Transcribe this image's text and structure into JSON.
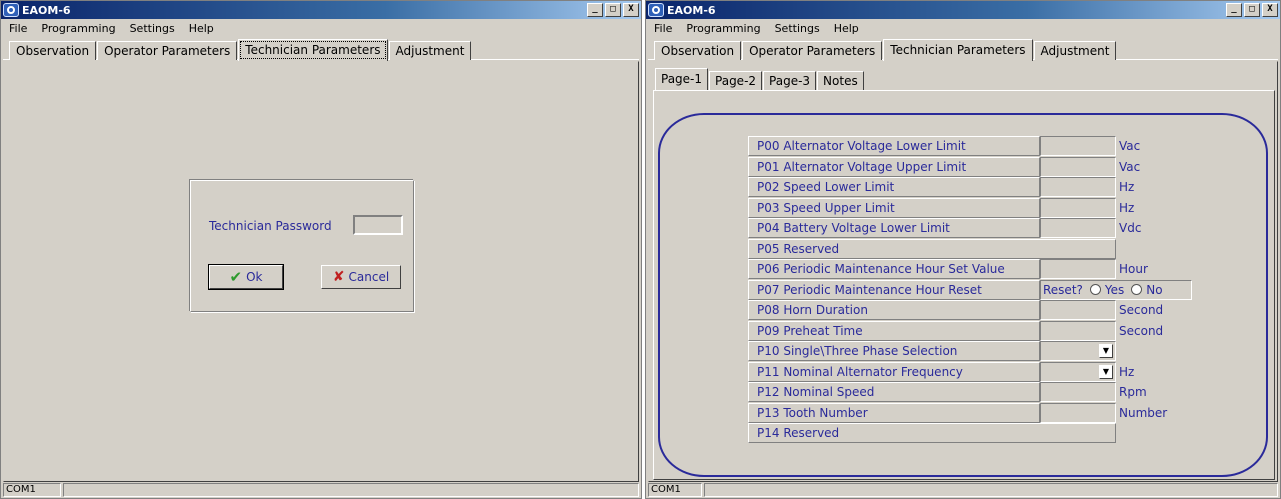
{
  "left_window": {
    "title": "EAOM-6",
    "buttons": {
      "minimize": "_",
      "maximize": "□",
      "close": "X"
    },
    "menu": [
      {
        "label": "File"
      },
      {
        "label": "Programming"
      },
      {
        "label": "Settings"
      },
      {
        "label": "Help"
      }
    ],
    "tabs": [
      "Observation",
      "Operator Parameters",
      "Technician Parameters",
      "Adjustment"
    ],
    "active_tab": "Technician Parameters",
    "dialog": {
      "password_label": "Technician Password",
      "password_value": "",
      "ok_label": "Ok",
      "cancel_label": "Cancel"
    },
    "status": {
      "port": "COM1",
      "message": ""
    }
  },
  "right_window": {
    "title": "EAOM-6",
    "buttons": {
      "minimize": "_",
      "maximize": "□",
      "close": "X"
    },
    "menu": [
      {
        "label": "File"
      },
      {
        "label": "Programming"
      },
      {
        "label": "Settings"
      },
      {
        "label": "Help"
      }
    ],
    "tabs": [
      "Observation",
      "Operator Parameters",
      "Technician Parameters",
      "Adjustment"
    ],
    "active_tab": "Technician Parameters",
    "subtabs": [
      "Page-1",
      "Page-2",
      "Page-3",
      "Notes"
    ],
    "active_subtab": "Page-1",
    "params": [
      {
        "name": "P00  Alternator Voltage Lower Limit",
        "kind": "field",
        "unit": "Vac",
        "value": ""
      },
      {
        "name": "P01  Alternator Voltage Upper Limit",
        "kind": "field",
        "unit": "Vac",
        "value": ""
      },
      {
        "name": "P02  Speed Lower Limit",
        "kind": "field",
        "unit": "Hz",
        "value": ""
      },
      {
        "name": "P03  Speed Upper Limit",
        "kind": "field",
        "unit": "Hz",
        "value": ""
      },
      {
        "name": "P04  Battery Voltage Lower Limit",
        "kind": "field",
        "unit": "Vdc",
        "value": ""
      },
      {
        "name": "P05  Reserved",
        "kind": "reserved",
        "unit": "",
        "value": ""
      },
      {
        "name": "P06  Periodic Maintenance Hour Set Value",
        "kind": "field",
        "unit": "Hour",
        "value": ""
      },
      {
        "name": "P07  Periodic Maintenance Hour Reset",
        "kind": "reset",
        "unit": "",
        "value": "",
        "reset_label": "Reset?",
        "yes_label": "Yes",
        "no_label": "No"
      },
      {
        "name": "P08  Horn Duration",
        "kind": "field",
        "unit": "Second",
        "value": ""
      },
      {
        "name": "P09  Preheat Time",
        "kind": "field",
        "unit": "Second",
        "value": ""
      },
      {
        "name": "P10  Single\\Three Phase Selection",
        "kind": "select",
        "unit": "",
        "value": ""
      },
      {
        "name": "P11  Nominal Alternator Frequency",
        "kind": "select",
        "unit": "Hz",
        "value": ""
      },
      {
        "name": "P12  Nominal Speed",
        "kind": "field",
        "unit": "Rpm",
        "value": ""
      },
      {
        "name": "P13  Tooth Number",
        "kind": "field",
        "unit": "Number",
        "value": ""
      },
      {
        "name": "P14  Reserved",
        "kind": "reserved",
        "unit": "",
        "value": ""
      }
    ],
    "status": {
      "port": "COM1",
      "message": ""
    }
  }
}
